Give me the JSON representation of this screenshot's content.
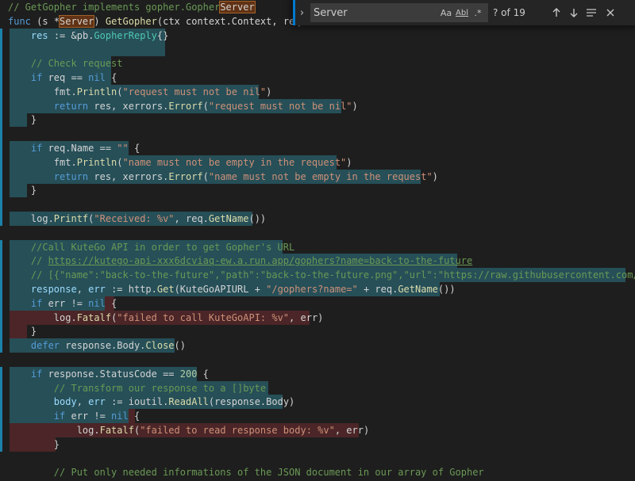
{
  "find_widget": {
    "search_value": "Server",
    "match_count": "? of 19",
    "options": {
      "match_case": "Aa",
      "whole_word": "Abl",
      "regex": ".*"
    },
    "icons": {
      "toggle": "chevron-right-icon",
      "prev": "arrow-up-icon",
      "next": "arrow-down-icon",
      "selection": "find-in-selection-icon",
      "close": "close-icon"
    }
  },
  "code_lines": [
    {
      "gutter": "",
      "hl": [],
      "tokens": [
        [
          "cm",
          "// GetGopher implements gopher.Gopher"
        ],
        [
          "match",
          "Server"
        ]
      ]
    },
    {
      "gutter": "",
      "hl": [],
      "tokens": [
        [
          "kw",
          "func"
        ],
        [
          "pl",
          " (s *"
        ],
        [
          "match",
          "Server"
        ],
        [
          "pl",
          ") "
        ],
        [
          "fn",
          "GetGopher"
        ],
        [
          "pl",
          "(ctx context.Context, req"
        ]
      ]
    },
    {
      "gutter": "mod",
      "hl": [
        [
          "blue",
          12,
          208
        ]
      ],
      "tokens": [
        [
          "pl",
          "    "
        ],
        [
          "id",
          "res"
        ],
        [
          "pl",
          " := &pb."
        ],
        [
          "ty",
          "GopherReply"
        ],
        [
          "pl",
          "{}"
        ]
      ]
    },
    {
      "gutter": "mod",
      "hl": [
        [
          "blue",
          12,
          208
        ]
      ],
      "tokens": [
        [
          "pl",
          ""
        ]
      ]
    },
    {
      "gutter": "mod",
      "hl": [
        [
          "blue",
          12,
          140
        ]
      ],
      "tokens": [
        [
          "cm",
          "    // Check request"
        ]
      ]
    },
    {
      "gutter": "mod",
      "hl": [
        [
          "blue",
          12,
          140
        ]
      ],
      "tokens": [
        [
          "kw",
          "    if"
        ],
        [
          "pl",
          " req == "
        ],
        [
          "kw",
          "nil"
        ],
        [
          "pl",
          " {"
        ]
      ]
    },
    {
      "gutter": "mod",
      "hl": [
        [
          "blue",
          12,
          326
        ]
      ],
      "tokens": [
        [
          "pl",
          "        fmt."
        ],
        [
          "fn",
          "Println"
        ],
        [
          "pl",
          "("
        ],
        [
          "str",
          "\"request must not be nil\""
        ],
        [
          "pl",
          ")"
        ]
      ]
    },
    {
      "gutter": "mod",
      "hl": [
        [
          "blue",
          12,
          430
        ]
      ],
      "tokens": [
        [
          "kw",
          "        return"
        ],
        [
          "pl",
          " res, xerrors."
        ],
        [
          "fn",
          "Errorf"
        ],
        [
          "pl",
          "("
        ],
        [
          "str",
          "\"request must not be nil\""
        ],
        [
          "pl",
          ")"
        ]
      ]
    },
    {
      "gutter": "mod",
      "hl": [
        [
          "blue",
          12,
          34
        ]
      ],
      "tokens": [
        [
          "pl",
          "    }"
        ]
      ]
    },
    {
      "gutter": "mod",
      "hl": [],
      "tokens": [
        [
          "pl",
          ""
        ]
      ]
    },
    {
      "gutter": "mod",
      "hl": [
        [
          "blue",
          12,
          162
        ]
      ],
      "tokens": [
        [
          "kw",
          "    if"
        ],
        [
          "pl",
          " req.Name == "
        ],
        [
          "str",
          "\"\""
        ],
        [
          "pl",
          " {"
        ]
      ]
    },
    {
      "gutter": "mod",
      "hl": [
        [
          "blue",
          12,
          424
        ]
      ],
      "tokens": [
        [
          "pl",
          "        fmt."
        ],
        [
          "fn",
          "Println"
        ],
        [
          "pl",
          "("
        ],
        [
          "str",
          "\"name must not be empty in the request\""
        ],
        [
          "pl",
          ")"
        ]
      ]
    },
    {
      "gutter": "mod",
      "hl": [
        [
          "blue",
          12,
          530
        ]
      ],
      "tokens": [
        [
          "kw",
          "        return"
        ],
        [
          "pl",
          " res, xerrors."
        ],
        [
          "fn",
          "Errorf"
        ],
        [
          "pl",
          "("
        ],
        [
          "str",
          "\"name must not be empty in the request\""
        ],
        [
          "pl",
          ")"
        ]
      ]
    },
    {
      "gutter": "mod",
      "hl": [
        [
          "blue",
          12,
          34
        ]
      ],
      "tokens": [
        [
          "pl",
          "    }"
        ]
      ]
    },
    {
      "gutter": "mod",
      "hl": [],
      "tokens": [
        [
          "pl",
          ""
        ]
      ]
    },
    {
      "gutter": "mod",
      "hl": [
        [
          "blue",
          12,
          318
        ]
      ],
      "tokens": [
        [
          "pl",
          "    log."
        ],
        [
          "fn",
          "Printf"
        ],
        [
          "pl",
          "("
        ],
        [
          "str",
          "\"Received: %v\""
        ],
        [
          "pl",
          ", req."
        ],
        [
          "fn",
          "GetName"
        ],
        [
          "pl",
          "())"
        ]
      ]
    },
    {
      "gutter": "",
      "hl": [],
      "tokens": [
        [
          "pl",
          ""
        ]
      ]
    },
    {
      "gutter": "mod",
      "hl": [
        [
          "blue",
          12,
          356
        ]
      ],
      "tokens": [
        [
          "cm",
          "    //Call KuteGo API in order to get Gopher's URL"
        ]
      ]
    },
    {
      "gutter": "mod",
      "hl": [
        [
          "blue",
          12,
          576
        ]
      ],
      "tokens": [
        [
          "cm",
          "    // "
        ],
        [
          "lnk",
          "https://kutego-api-xxx6dcviaq-ew.a.run.app/gophers?name=back-to-the-future"
        ]
      ]
    },
    {
      "gutter": "mod",
      "hl": [
        [
          "blue",
          12,
          788
        ]
      ],
      "tokens": [
        [
          "cm",
          "    // [{\"name\":\"back-to-the-future\",\"path\":\"back-to-the-future.png\",\"url\":\"https://raw.githubusercontent.com/"
        ]
      ]
    },
    {
      "gutter": "mod",
      "hl": [
        [
          "blue",
          12,
          554
        ]
      ],
      "tokens": [
        [
          "id",
          "    response"
        ],
        [
          "pl",
          ", "
        ],
        [
          "id",
          "err"
        ],
        [
          "pl",
          " := http."
        ],
        [
          "fn",
          "Get"
        ],
        [
          "pl",
          "(KuteGoAPIURL + "
        ],
        [
          "str",
          "\"/gophers?name=\""
        ],
        [
          "pl",
          " + req."
        ],
        [
          "fn",
          "GetName"
        ],
        [
          "pl",
          "())"
        ]
      ]
    },
    {
      "gutter": "mod",
      "hl": [
        [
          "blue",
          12,
          132
        ],
        [
          "red",
          132,
          144
        ]
      ],
      "tokens": [
        [
          "kw",
          "    if"
        ],
        [
          "pl",
          " err != "
        ],
        [
          "kw",
          "nil"
        ],
        [
          "pl",
          " {"
        ]
      ]
    },
    {
      "gutter": "del",
      "hl": [
        [
          "red",
          12,
          390
        ]
      ],
      "tokens": [
        [
          "pl",
          "        log."
        ],
        [
          "fn",
          "Fatalf"
        ],
        [
          "pl",
          "("
        ],
        [
          "str",
          "\"failed to call KuteGoAPI: %v\""
        ],
        [
          "pl",
          ", err)"
        ]
      ]
    },
    {
      "gutter": "del",
      "hl": [
        [
          "red",
          12,
          34
        ]
      ],
      "tokens": [
        [
          "pl",
          "    }"
        ]
      ]
    },
    {
      "gutter": "mod",
      "hl": [
        [
          "blue",
          12,
          220
        ]
      ],
      "tokens": [
        [
          "kw",
          "    defer"
        ],
        [
          "pl",
          " response.Body."
        ],
        [
          "fn",
          "Close"
        ],
        [
          "pl",
          "()"
        ]
      ]
    },
    {
      "gutter": "",
      "hl": [],
      "tokens": [
        [
          "pl",
          ""
        ]
      ]
    },
    {
      "gutter": "mod",
      "hl": [
        [
          "blue",
          12,
          248
        ]
      ],
      "tokens": [
        [
          "kw",
          "    if"
        ],
        [
          "pl",
          " response.StatusCode == "
        ],
        [
          "num",
          "200"
        ],
        [
          "pl",
          " {"
        ]
      ]
    },
    {
      "gutter": "mod",
      "hl": [
        [
          "blue",
          12,
          338
        ]
      ],
      "tokens": [
        [
          "cm",
          "        // Transform our response to a []byte"
        ]
      ]
    },
    {
      "gutter": "mod",
      "hl": [
        [
          "blue",
          12,
          356
        ]
      ],
      "tokens": [
        [
          "id",
          "        body"
        ],
        [
          "pl",
          ", "
        ],
        [
          "id",
          "err"
        ],
        [
          "pl",
          " := ioutil."
        ],
        [
          "fn",
          "ReadAll"
        ],
        [
          "pl",
          "(response.Body)"
        ]
      ]
    },
    {
      "gutter": "mod",
      "hl": [
        [
          "blue",
          12,
          162
        ],
        [
          "red",
          162,
          170
        ]
      ],
      "tokens": [
        [
          "kw",
          "        if"
        ],
        [
          "pl",
          " err != "
        ],
        [
          "kw",
          "nil"
        ],
        [
          "pl",
          " {"
        ]
      ]
    },
    {
      "gutter": "del",
      "hl": [
        [
          "red",
          12,
          452
        ]
      ],
      "tokens": [
        [
          "pl",
          "            log."
        ],
        [
          "fn",
          "Fatalf"
        ],
        [
          "pl",
          "("
        ],
        [
          "str",
          "\"failed to read response body: %v\""
        ],
        [
          "pl",
          ", err)"
        ]
      ]
    },
    {
      "gutter": "del",
      "hl": [
        [
          "red",
          12,
          70
        ]
      ],
      "tokens": [
        [
          "pl",
          "        }"
        ]
      ]
    },
    {
      "gutter": "",
      "hl": [],
      "tokens": [
        [
          "pl",
          ""
        ]
      ]
    },
    {
      "gutter": "",
      "hl": [],
      "tokens": [
        [
          "cm",
          "        // Put only needed informations of the JSON document in our array of Gopher"
        ]
      ]
    }
  ]
}
